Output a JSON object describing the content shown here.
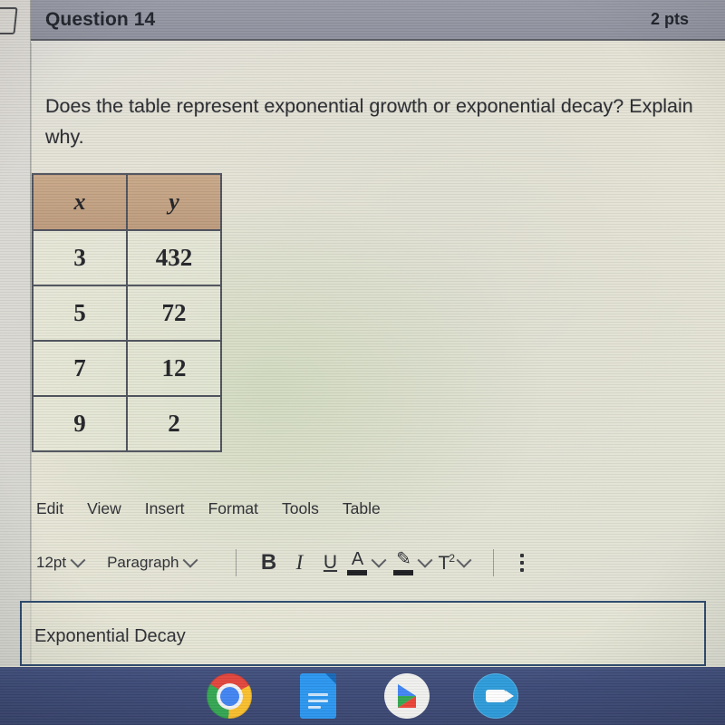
{
  "header": {
    "question_label": "Question 14",
    "points": "2 pts",
    "bar_color": "#93959f"
  },
  "prompt": {
    "text": "Does the table represent exponential growth or exponential decay? Explain why."
  },
  "table": {
    "columns": [
      "x",
      "y"
    ],
    "rows": [
      {
        "x": "3",
        "y": "432"
      },
      {
        "x": "5",
        "y": "72"
      },
      {
        "x": "7",
        "y": "12"
      },
      {
        "x": "9",
        "y": "2"
      }
    ],
    "header_bg": "#c2a182"
  },
  "editor": {
    "menu": [
      {
        "label": "Edit"
      },
      {
        "label": "View"
      },
      {
        "label": "Insert"
      },
      {
        "label": "Format"
      },
      {
        "label": "Tools"
      },
      {
        "label": "Table"
      }
    ],
    "toolbar": {
      "font_size": "12pt",
      "block_format": "Paragraph",
      "bold": "B",
      "italic": "I",
      "underline": "U",
      "text_color": "A",
      "highlight": "✎",
      "superscript_base": "T",
      "superscript_exp": "2",
      "more_options": "more-options"
    },
    "answer": {
      "value": "Exponential Decay",
      "placeholder": "",
      "border_color": "#2c4a6e"
    }
  },
  "taskbar": {
    "background": "#3c4a76",
    "apps": [
      {
        "name": "chrome"
      },
      {
        "name": "google-docs"
      },
      {
        "name": "google-play"
      },
      {
        "name": "zoom"
      }
    ]
  }
}
